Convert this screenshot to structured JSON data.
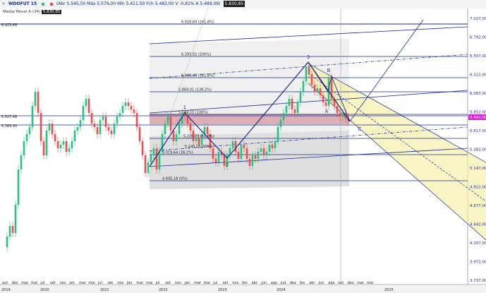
{
  "header": {
    "close_glyph": "×",
    "symbol": "WDOFUT 15",
    "ohlc_text": "(Abr 5.545,50 Máx 5.579,00 Mín 5.411,50 Fch 5.482,00 V -0,81% A 5.489,08)",
    "last_value": "5.830,85",
    "colors": {
      "up": "#26c281",
      "down": "#ef4d4d",
      "accent": "#1b2c8c"
    }
  },
  "indicator": {
    "label": "Média Móvel A (34)",
    "value": "5.830,85"
  },
  "left_labels": [
    "6.923,66",
    "5.507,48",
    "5.383,90"
  ],
  "fib_levels": [
    {
      "label": "6.918,84 (261,8%)"
    },
    {
      "label": "6.393,92 (200%)"
    },
    {
      "label": "6.069,46 (161,8%)"
    },
    {
      "label": "5.869,01 (138,2%)"
    },
    {
      "label": "5.544,55 (100%)"
    },
    {
      "label": "5.220,09 (61,8%)"
    },
    {
      "label": "5.019,64 (38,2%)"
    },
    {
      "label": "4.695,18 (0%)"
    }
  ],
  "fib_partial": "5.140,25 (50%)",
  "wave_labels": [
    "1",
    "2",
    "3",
    "A",
    "B",
    "C"
  ],
  "y_axis": {
    "ticks": [
      "7.027,00",
      "6.792,00",
      "6.557,00",
      "6.322,00",
      "6.087,00",
      "5.852,00",
      "5.617,00",
      "5.382,00",
      "5.147,00",
      "4.912,00",
      "4.677,00",
      "4.442,00",
      "4.207,00",
      "3.972,00",
      "3.737,00"
    ],
    "last_price": "5.482,00",
    "last_price_color": "#d81fd8"
  },
  "x_axis": {
    "months": [
      "out",
      "dez",
      "mar",
      "mai",
      "jul",
      "set",
      "nov",
      "jan",
      "mar",
      "mai",
      "jul",
      "set",
      "nov",
      "jan",
      "mar",
      "mai",
      "jul",
      "set",
      "nov",
      "jan",
      "mar",
      "mai",
      "jul",
      "set",
      "nov",
      "fev",
      "abr",
      "jun",
      "ago",
      "out",
      "dez",
      "fev",
      "abr",
      "jun",
      "ago",
      "out",
      "dez",
      "mar",
      "mai"
    ],
    "years": [
      "2019",
      "2020",
      "2021",
      "2022",
      "2023",
      "2024",
      "2025"
    ]
  }
}
